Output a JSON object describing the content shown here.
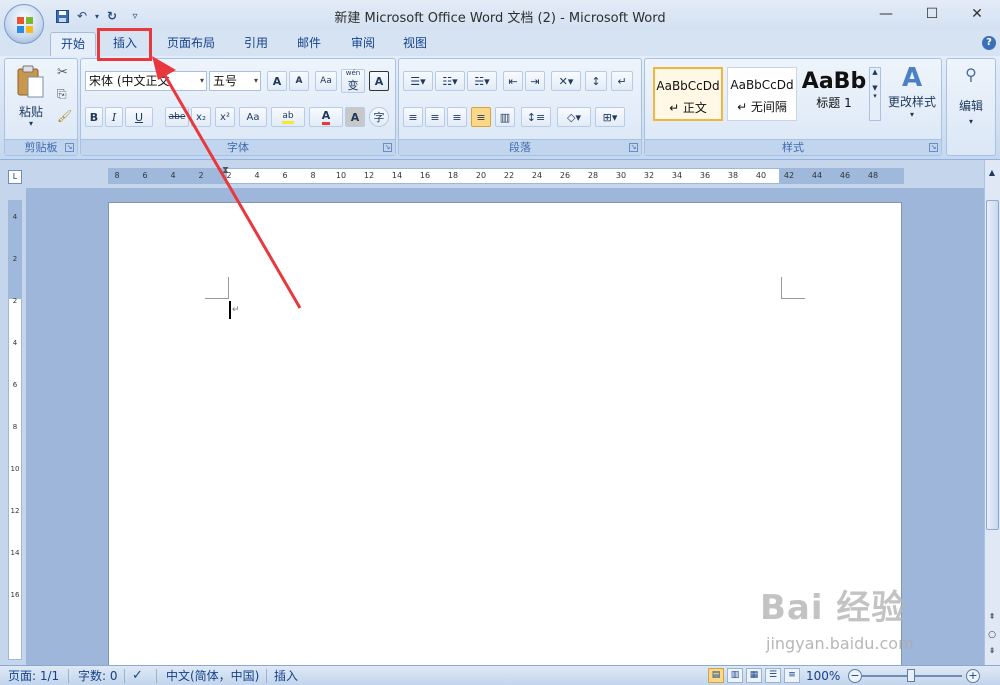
{
  "window": {
    "title": "新建 Microsoft Office Word 文档 (2) - Microsoft Word",
    "controls": [
      "—",
      "☐",
      "✕"
    ]
  },
  "quick_access": {
    "save_icon": "save-icon",
    "undo_icon": "undo-icon",
    "redo_icon": "redo-icon",
    "customize_icon": "customize-qat-icon"
  },
  "tabs": [
    "开始",
    "插入",
    "页面布局",
    "引用",
    "邮件",
    "审阅",
    "视图"
  ],
  "ribbon": {
    "clipboard": {
      "label": "剪贴板",
      "paste": "粘贴"
    },
    "font": {
      "label": "字体",
      "font_name": "宋体 (中文正文",
      "font_size": "五号",
      "grow": "A",
      "shrink": "A",
      "clear": "Aa",
      "phonetic": "wén",
      "phonetic_char": "变",
      "border_char": "A",
      "bold": "B",
      "italic": "I",
      "underline": "U",
      "strike": "abe",
      "sub": "x₂",
      "sup": "x²",
      "case": "Aa",
      "highlight": "ab",
      "font_color": "A",
      "shading_char": "A",
      "enclose_char": "字"
    },
    "paragraph": {
      "label": "段落"
    },
    "styles": {
      "label": "样式",
      "items": [
        {
          "sample": "AaBbCcDd",
          "name": "↵ 正文"
        },
        {
          "sample": "AaBbCcDd",
          "name": "↵ 无间隔"
        },
        {
          "sample": "AaBb",
          "name": "标题 1"
        }
      ],
      "change_styles": "更改样式"
    },
    "editing": {
      "label": "编辑"
    }
  },
  "ruler": {
    "ticks": [
      "8",
      "6",
      "4",
      "2",
      "2",
      "4",
      "6",
      "8",
      "10",
      "12",
      "14",
      "16",
      "18",
      "20",
      "22",
      "24",
      "26",
      "28",
      "30",
      "32",
      "34",
      "36",
      "38",
      "40",
      "42",
      "44",
      "46",
      "48"
    ],
    "vticks": [
      "4",
      "2",
      "2",
      "4",
      "6",
      "8",
      "10",
      "12",
      "14",
      "16"
    ]
  },
  "statusbar": {
    "page": "页面: 1/1",
    "words": "字数: 0",
    "language": "中文(简体，中国)",
    "mode": "插入",
    "zoom": "100%"
  },
  "watermark": {
    "main": "Bai 经验",
    "sub": "jingyan.baidu.com"
  },
  "colors": {
    "highlight": "#e8383d",
    "ribbon_bg": "#d1dff1",
    "accent": "#15428b"
  }
}
